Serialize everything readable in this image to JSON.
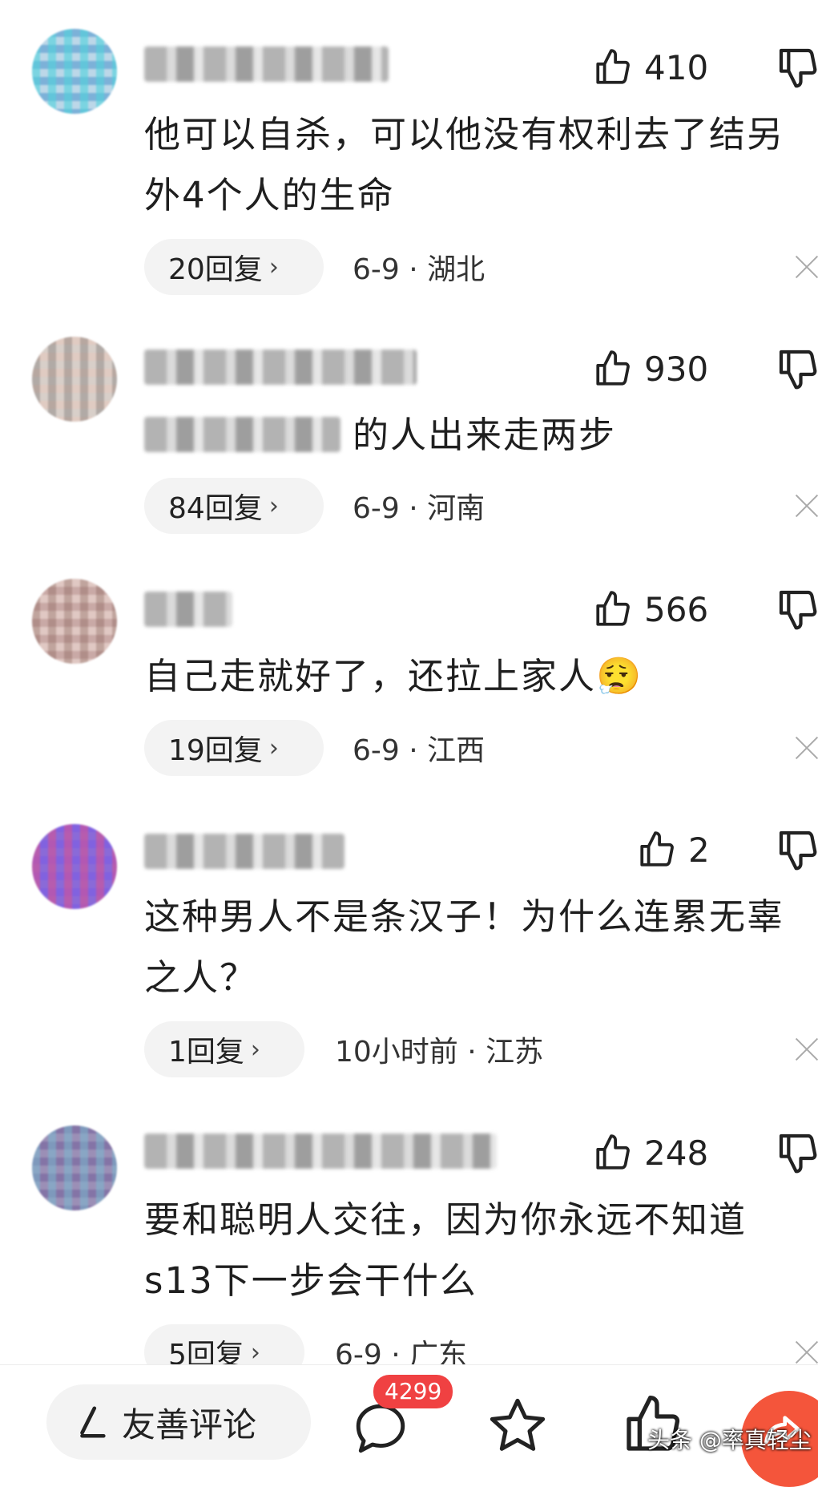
{
  "comments": [
    {
      "like_count": "410",
      "text": "他可以自杀，可以他没有权利去了结另外4个人的生命",
      "replies_label": "20回复",
      "time_location": "6-9 · 湖北"
    },
    {
      "like_count": "930",
      "text": "的人出来走两步",
      "replies_label": "84回复",
      "time_location": "6-9 · 河南"
    },
    {
      "like_count": "566",
      "text": "自己走就好了，还拉上家人😮‍💨",
      "replies_label": "19回复",
      "time_location": "6-9 · 江西"
    },
    {
      "like_count": "2",
      "text": "这种男人不是条汉子！为什么连累无辜之人？",
      "replies_label": "1回复",
      "time_location": "10小时前 · 江苏"
    },
    {
      "like_count": "248",
      "text": "要和聪明人交往，因为你永远不知道s13下一步会干什么",
      "replies_label": "5回复",
      "time_location": "6-9 · 广东"
    }
  ],
  "bottom_bar": {
    "write_label": "友善评论",
    "comment_count": "4299",
    "watermark": "头条 @率真轻尘"
  },
  "colors": {
    "badge": "#f04142",
    "share": "#f4553b"
  }
}
